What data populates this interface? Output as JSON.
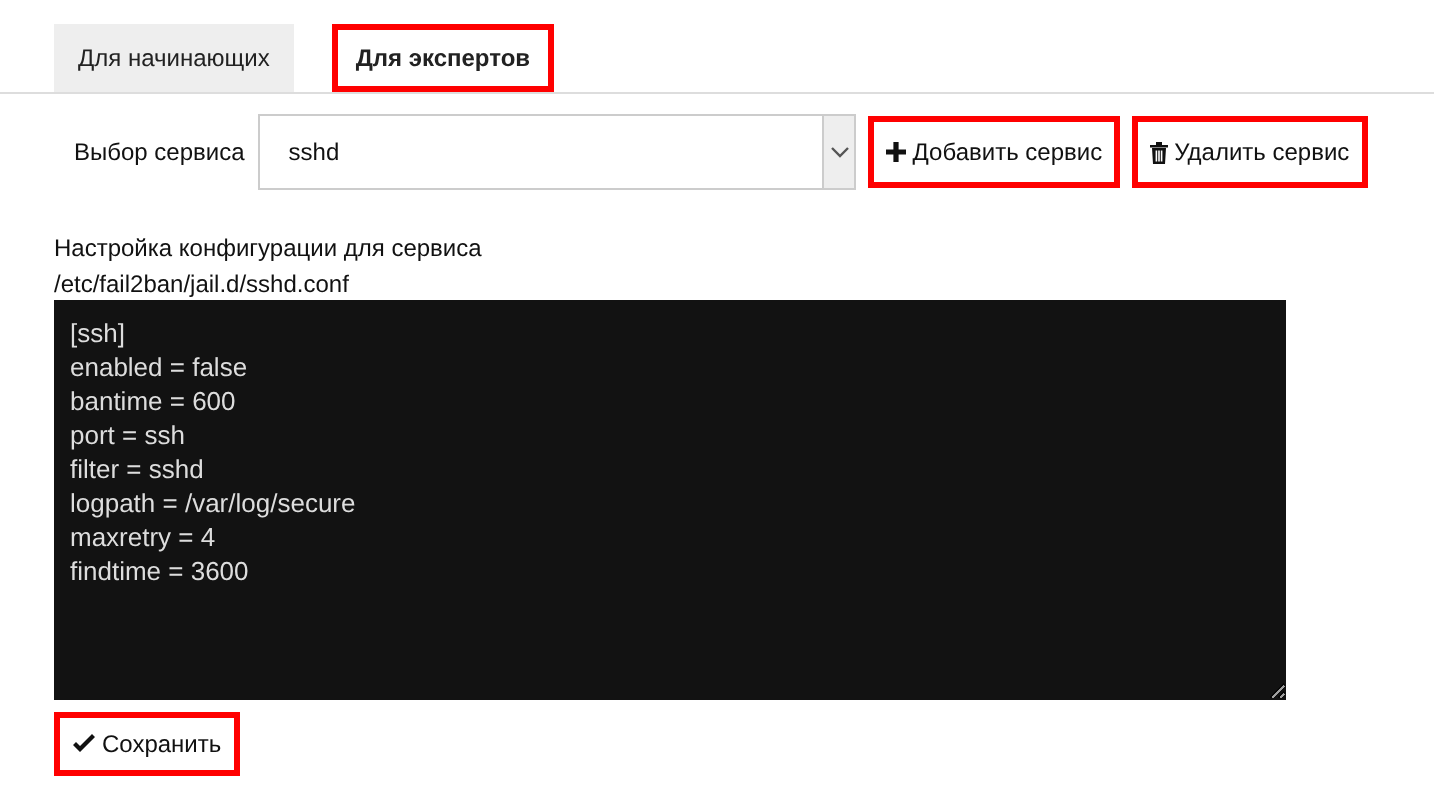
{
  "tabs": [
    {
      "label": "Для начинающих",
      "selected": false,
      "highlighted": false
    },
    {
      "label": "Для экспертов",
      "selected": true,
      "highlighted": true
    }
  ],
  "service_select": {
    "label": "Выбор сервиса",
    "value": "sshd"
  },
  "buttons": [
    {
      "kind": "add",
      "label": "Добавить сервис",
      "highlighted": true
    },
    {
      "kind": "delete",
      "label": "Удалить сервис",
      "highlighted": true
    }
  ],
  "config": {
    "title": "Настройка конфигурации для сервиса",
    "path": "/etc/fail2ban/jail.d/sshd.conf",
    "lines": [
      "[ssh]",
      "enabled = false",
      "bantime = 600",
      "port = ssh",
      "filter = sshd",
      "logpath = /var/log/secure",
      "maxretry = 4",
      "findtime = 3600"
    ]
  },
  "save_button": {
    "label": "Сохранить",
    "highlighted": true
  }
}
